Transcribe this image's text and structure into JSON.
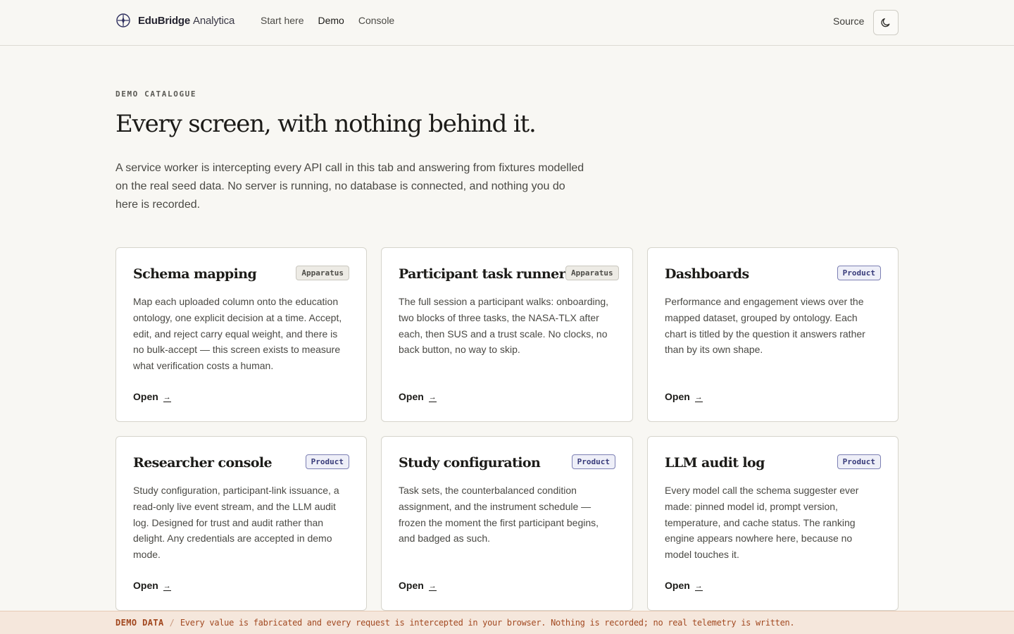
{
  "header": {
    "brand_bold": "EduBridge",
    "brand_light": "Analytica",
    "brand_icon": "compass-icon",
    "nav": [
      "Start here",
      "Demo",
      "Console"
    ],
    "active_nav": "Demo",
    "source_label": "Source",
    "theme_icon": "moon-icon"
  },
  "hero": {
    "eyebrow": "DEMO CATALOGUE",
    "title": "Every screen, with nothing behind it.",
    "lede": "A service worker is intercepting every API call in this tab and answering from fixtures modelled on the real seed data. No server is running, no database is connected, and nothing you do here is recorded."
  },
  "cards": [
    {
      "title": "Schema mapping",
      "tag": "Apparatus",
      "desc": "Map each uploaded column onto the education ontology, one explicit decision at a time. Accept, edit, and reject carry equal weight, and there is no bulk-accept — this screen exists to measure what verification costs a human.",
      "open": "Open",
      "arrow": "→"
    },
    {
      "title": "Participant task runner",
      "tag": "Apparatus",
      "desc": "The full session a participant walks: onboarding, two blocks of three tasks, the NASA-TLX after each, then SUS and a trust scale. No clocks, no back button, no way to skip.",
      "open": "Open",
      "arrow": "→"
    },
    {
      "title": "Dashboards",
      "tag": "Product",
      "desc": "Performance and engagement views over the mapped dataset, grouped by ontology. Each chart is titled by the question it answers rather than by its own shape.",
      "open": "Open",
      "arrow": "→"
    },
    {
      "title": "Researcher console",
      "tag": "Product",
      "desc": "Study configuration, participant-link issuance, a read-only live event stream, and the LLM audit log. Designed for trust and audit rather than delight. Any credentials are accepted in demo mode.",
      "open": "Open",
      "arrow": "→"
    },
    {
      "title": "Study configuration",
      "tag": "Product",
      "desc": "Task sets, the counterbalanced condition assignment, and the instrument schedule — frozen the moment the first participant begins, and badged as such.",
      "open": "Open",
      "arrow": "→"
    },
    {
      "title": "LLM audit log",
      "tag": "Product",
      "desc": "Every model call the schema suggester ever made: pinned model id, prompt version, temperature, and cache status. The ranking engine appears nowhere here, because no model touches it.",
      "open": "Open",
      "arrow": "→"
    }
  ],
  "banner": {
    "label": "DEMO DATA",
    "separator": "/",
    "message": "Every value is fabricated and every request is intercepted in your browser. Nothing is recorded; no real telemetry is written."
  },
  "colors": {
    "background": "#f8f7f3",
    "apparatus_tag": "#edebe5",
    "product_tag_text": "#383b7a",
    "banner_bg": "#f5e7dc",
    "banner_text": "#a24a22"
  }
}
